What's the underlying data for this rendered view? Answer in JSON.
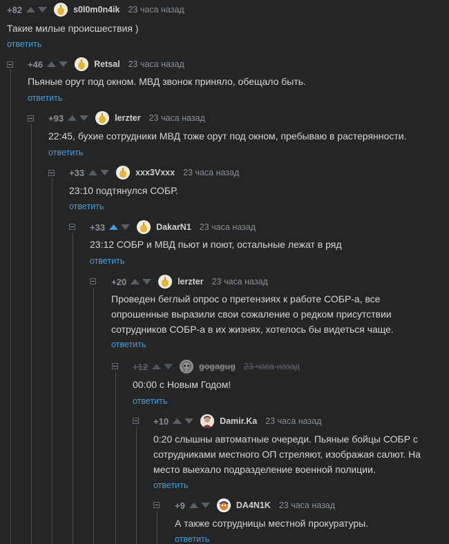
{
  "reply_label": "ответить",
  "comments": [
    {
      "score": "+82",
      "nick": "s0l0m0n4ik",
      "time": "23 часа назад",
      "text": "Такие милые происшествия )",
      "avatar": "pear-avatar-icon"
    },
    {
      "score": "+46",
      "nick": "Retsal",
      "time": "23 часа назад",
      "text": "Пьяные орут под окном. МВД звонок приняло, обещало быть.",
      "avatar": "pear-avatar-icon"
    },
    {
      "score": "+93",
      "nick": "lerzter",
      "time": "23 часа назад",
      "text": "22:45, бухие сотрудники МВД тоже орут под окном, пребываю в растерянности.",
      "avatar": "pear-avatar-icon"
    },
    {
      "score": "+33",
      "nick": "xxx3Vxxx",
      "time": "23 часа назад",
      "text": "23:10 подтянулся СОБР.",
      "avatar": "pear-avatar-icon"
    },
    {
      "score": "+33",
      "nick": "DakarN1",
      "time": "23 часа назад",
      "text": "23:12 СОБР и МВД пьют и поют, остальные лежат в ряд",
      "avatar": "pear-avatar-icon",
      "upvoted": true
    },
    {
      "score": "+20",
      "nick": "lerzter",
      "time": "23 часа назад",
      "text": "Проведен беглый опрос о претензиях к работе СОБР-а, все опрошенные выразили свои сожаление о редком присутствии сотрудников СОБР-а в их жизнях, хотелось бы видеться чаще.",
      "avatar": "pear-avatar-icon"
    },
    {
      "score": "+12",
      "nick": "gogagug",
      "time": "23 часа назад",
      "text": "00:00 с Новым Годом!",
      "avatar": "skull-avatar-icon",
      "deleted_style": true
    },
    {
      "score": "+10",
      "nick": "Damir.Ka",
      "time": "23 часа назад",
      "text": "0:20 слышны автоматные очереди. Пьяные бойцы СОБР с сотрудниками местного ОП стреляют, изображая салют. На место выехало подразделение военной полиции.",
      "avatar": "person-avatar-icon"
    },
    {
      "score": "+9",
      "nick": "DA4N1K",
      "time": "23 часа назад",
      "text": "А также сотрудницы местной прокуратуры.",
      "avatar": "cartoon-avatar-icon"
    }
  ],
  "colors": {
    "background": "#232527",
    "text": "#d6d7d8",
    "muted": "#8d9093",
    "link": "#4b9fd5",
    "upvote_active": "#4b9fd5"
  }
}
